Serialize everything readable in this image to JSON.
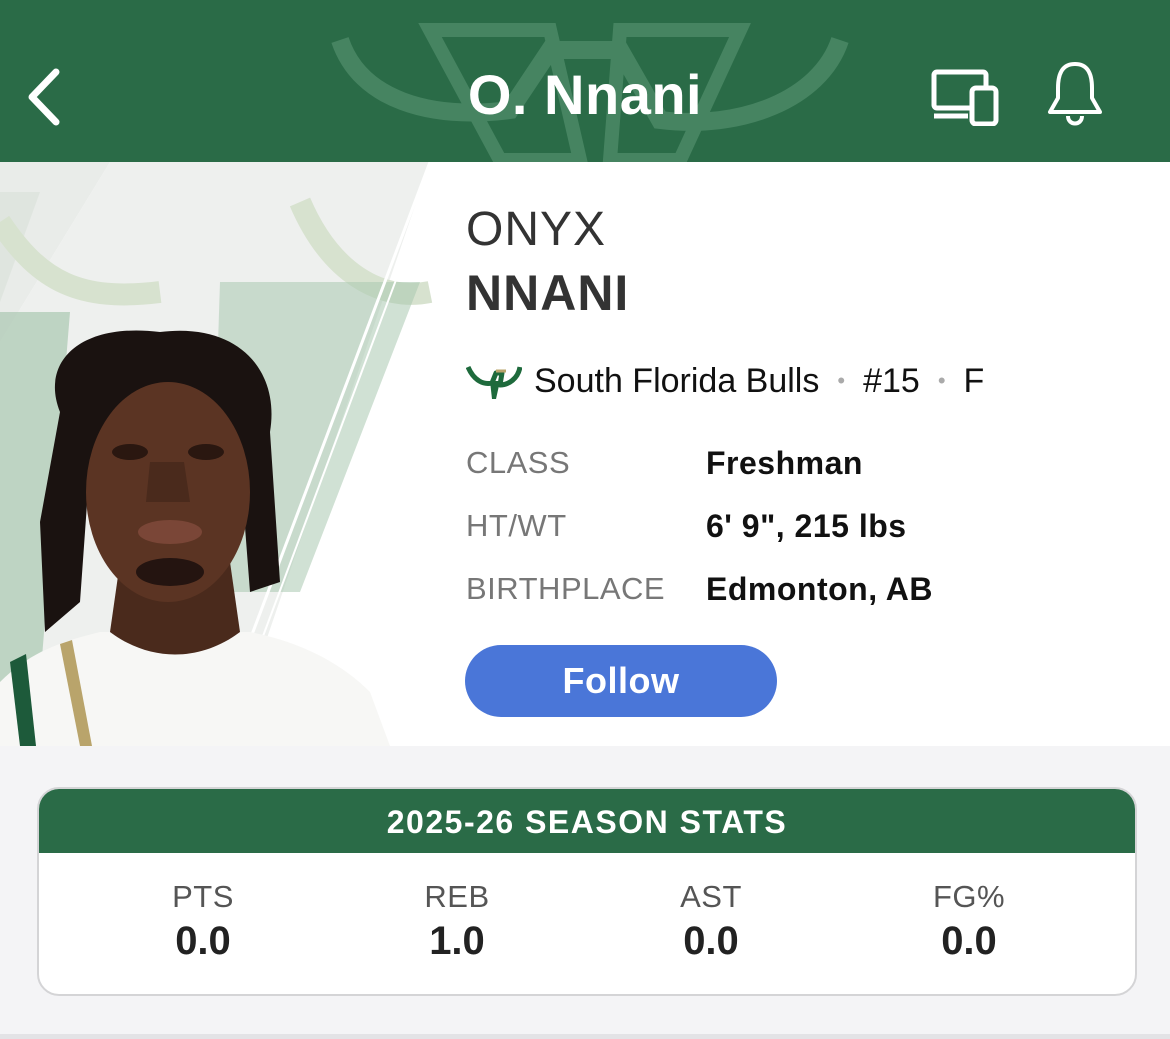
{
  "header": {
    "title": "O. Nnani",
    "back_icon": "chevron-left-icon",
    "cast_icon": "devices-icon",
    "bell_icon": "bell-icon"
  },
  "player": {
    "first_name": "ONYX",
    "last_name": "NNANI",
    "team": "South Florida Bulls",
    "number": "#15",
    "position": "F",
    "attributes": [
      {
        "label": "CLASS",
        "value": "Freshman"
      },
      {
        "label": "HT/WT",
        "value": "6' 9\", 215 lbs"
      },
      {
        "label": "BIRTHPLACE",
        "value": "Edmonton, AB"
      }
    ],
    "follow_label": "Follow"
  },
  "stats": {
    "title": "2025-26 SEASON STATS",
    "items": [
      {
        "label": "PTS",
        "value": "0.0"
      },
      {
        "label": "REB",
        "value": "1.0"
      },
      {
        "label": "AST",
        "value": "0.0"
      },
      {
        "label": "FG%",
        "value": "0.0"
      }
    ]
  },
  "colors": {
    "brand_green": "#2a6b47",
    "follow_blue": "#4a76d8"
  }
}
